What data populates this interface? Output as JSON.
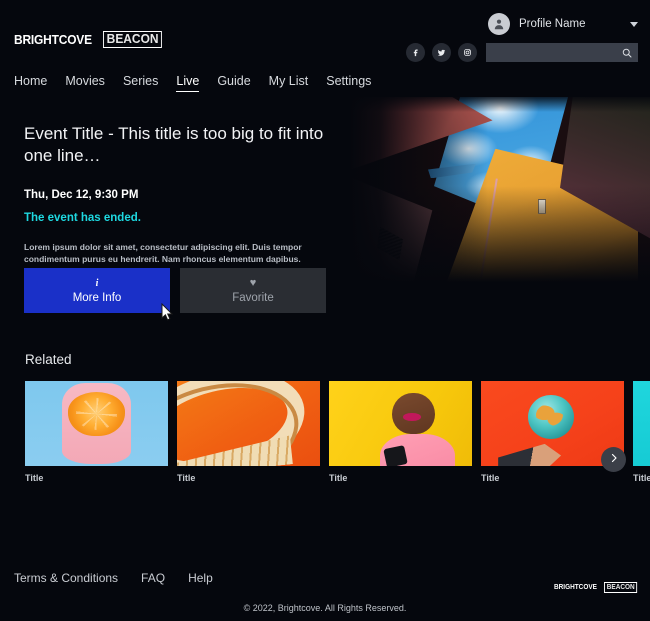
{
  "brand": {
    "logo_main": "BRIGHTCOVE",
    "logo_box": "BEACON",
    "accent_blue": "#1a30c8",
    "accent_cyan": "#1ed8e0",
    "background": "#05070d"
  },
  "header": {
    "profile": {
      "name": "Profile Name",
      "avatar_icon": "user-avatar-icon",
      "caret_icon": "chevron-down-icon"
    },
    "social": [
      {
        "name": "facebook-icon",
        "glyph": "f"
      },
      {
        "name": "twitter-icon",
        "glyph": "t"
      },
      {
        "name": "instagram-icon",
        "glyph": "ig"
      }
    ],
    "search": {
      "value": "",
      "placeholder": "",
      "icon": "search-icon"
    }
  },
  "nav": {
    "items": [
      {
        "label": "Home",
        "active": false
      },
      {
        "label": "Movies",
        "active": false
      },
      {
        "label": "Series",
        "active": false
      },
      {
        "label": "Live",
        "active": true
      },
      {
        "label": "Guide",
        "active": false
      },
      {
        "label": "My List",
        "active": false
      },
      {
        "label": "Settings",
        "active": false
      }
    ]
  },
  "event": {
    "title": "Event Title - This title is too big to fit into one line…",
    "date": "Thu, Dec 12, 9:30 PM",
    "status": "The event has ended.",
    "description": "Lorem ipsum dolor sit amet, consectetur adipiscing elit. Duis tempor condimentum purus eu hendrerit. Nam rhoncus elementum dapibus. Aliquam sed…",
    "buttons": [
      {
        "label": "More Info",
        "icon": "info-icon",
        "glyph": "i",
        "style": "primary"
      },
      {
        "label": "Favorite",
        "icon": "heart-icon",
        "glyph": "♥",
        "style": "secondary"
      }
    ]
  },
  "related": {
    "heading": "Related",
    "next_icon": "chevron-right-icon",
    "cards": [
      {
        "label": "Title",
        "art": "t1"
      },
      {
        "label": "Title",
        "art": "t2"
      },
      {
        "label": "Title",
        "art": "t3"
      },
      {
        "label": "Title",
        "art": "t4"
      },
      {
        "label": "Title",
        "art": "t5"
      }
    ]
  },
  "footer": {
    "links": [
      "Terms & Conditions",
      "FAQ",
      "Help"
    ],
    "copyright": "© 2022, Brightcove. All Rights Reserved.",
    "logo_main": "BRIGHTCOVE",
    "logo_box": "BEACON"
  }
}
